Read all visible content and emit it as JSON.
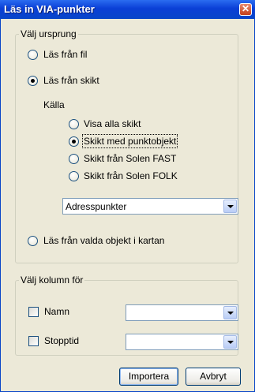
{
  "window": {
    "title": "Läs in VIA-punkter",
    "close_symbol": "✕"
  },
  "source_group": {
    "legend": "Välj ursprung",
    "read_from_file": "Läs från fil",
    "read_from_layer": "Läs från skikt",
    "kalla_label": "Källa",
    "options": [
      "Visa alla skikt",
      "Skikt med punktobjekt",
      "Skikt från Solen FAST",
      "Skikt från Solen FOLK"
    ],
    "layer_select_value": "Adresspunkter",
    "read_from_selected": "Läs från valda objekt i kartan"
  },
  "columns_group": {
    "legend": "Välj kolumn för",
    "name_label": "Namn",
    "name_value": "",
    "stop_label": "Stopptid",
    "stop_value": ""
  },
  "buttons": {
    "import": "Importera",
    "cancel": "Avbryt"
  }
}
